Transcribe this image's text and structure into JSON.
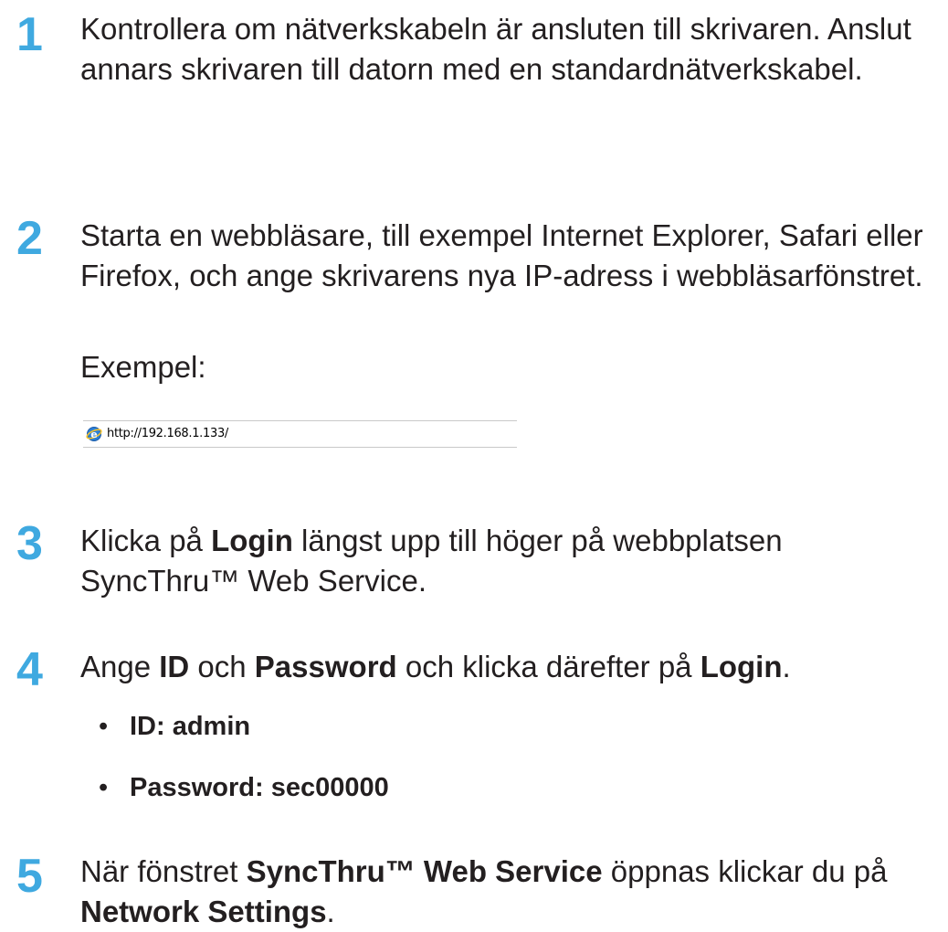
{
  "steps": [
    {
      "number": "1",
      "text": "Kontrollera om nätverkskabeln är ansluten till skrivaren. Anslut annars skrivaren till datorn med en standardnätverkskabel."
    },
    {
      "number": "2",
      "text": "Starta en webbläsare, till exempel Internet Explorer, Safari eller Firefox, och ange skrivarens nya IP-adress i webbläsarfönstret.",
      "example_label": "Exempel:"
    },
    {
      "number": "3",
      "text_a": "Klicka på ",
      "bold_a": "Login",
      "text_b": " längst upp till höger på webbplatsen SyncThru™ Web Service."
    },
    {
      "number": "4",
      "text_a": "Ange ",
      "bold_a": "ID",
      "text_b": " och ",
      "bold_b": "Password",
      "text_c": " och klicka därefter på ",
      "bold_c": "Login",
      "text_d": "."
    },
    {
      "number": "5",
      "text_a": "När fönstret ",
      "bold_a": "SyncThru™ Web Service",
      "text_b": " öppnas klickar du på ",
      "bold_b": "Network Settings",
      "text_c": "."
    }
  ],
  "address_bar": {
    "url": "http://192.168.1.133/",
    "icon": "internet-explorer-icon"
  },
  "credentials": {
    "bullet": "•",
    "id": "ID: admin",
    "password": "Password: sec00000"
  },
  "colors": {
    "step_number": "#3fa9e0",
    "text": "#231f20"
  }
}
